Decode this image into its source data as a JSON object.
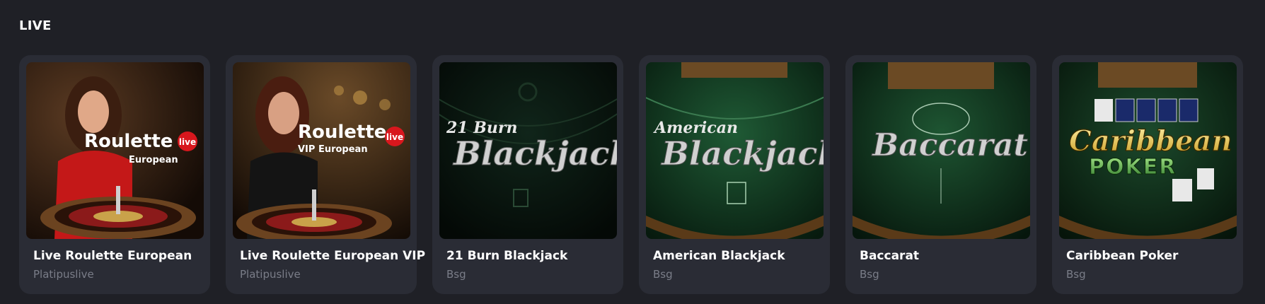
{
  "section": {
    "title": "LIVE"
  },
  "colors": {
    "background": "#1f2026",
    "card": "#2a2c35",
    "provider_text": "#7a7d88",
    "live_badge": "#d8171d"
  },
  "games": [
    {
      "title": "Live Roulette European",
      "provider": "Platipuslive",
      "thumb_line1": "Roulette",
      "thumb_line2": "European",
      "badge": "live"
    },
    {
      "title": "Live Roulette European VIP",
      "provider": "Platipuslive",
      "thumb_line1": "Roulette",
      "thumb_line2": "VIP European",
      "badge": "live"
    },
    {
      "title": "21 Burn Blackjack",
      "provider": "Bsg",
      "thumb_small": "21 Burn",
      "thumb_big": "Blackjack"
    },
    {
      "title": "American Blackjack",
      "provider": "Bsg",
      "thumb_small": "American",
      "thumb_big": "Blackjack"
    },
    {
      "title": "Baccarat",
      "provider": "Bsg",
      "thumb_big": "Baccarat"
    },
    {
      "title": "Caribbean Poker",
      "provider": "Bsg",
      "thumb_line1": "Caribbean",
      "thumb_line2": "POKER"
    }
  ]
}
